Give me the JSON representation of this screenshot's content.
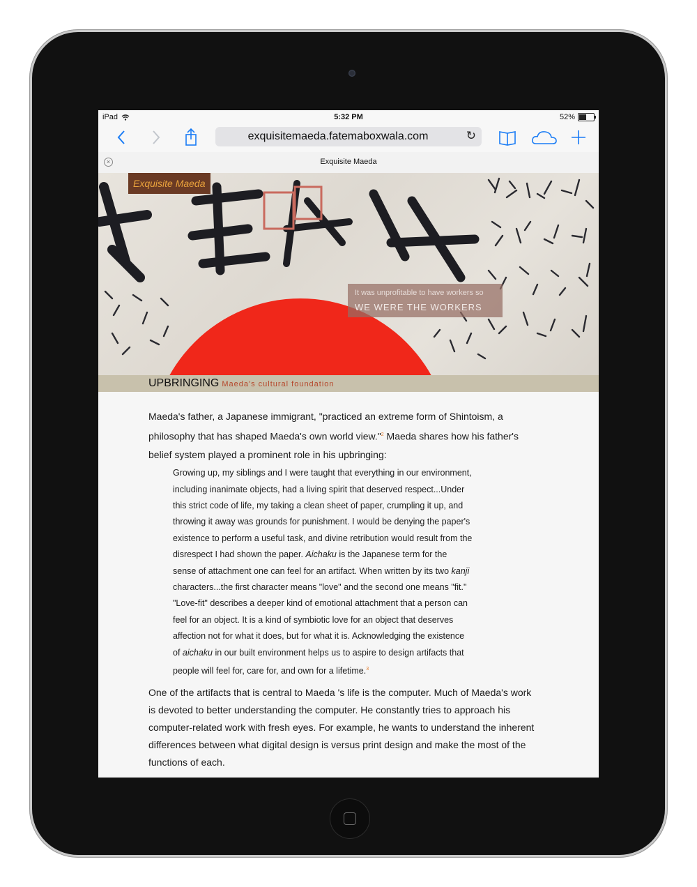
{
  "statusbar": {
    "device": "iPad",
    "time": "5:32 PM",
    "battery_pct": "52%",
    "battery_level": 0.52
  },
  "toolbar": {
    "back_icon": "chevron-left-icon",
    "forward_icon": "chevron-right-icon",
    "share_icon": "share-icon",
    "url": "exquisitemaeda.fatemaboxwala.com",
    "reload_icon": "reload-icon",
    "bookmarks_icon": "book-icon",
    "cloud_icon": "cloud-icon",
    "add_icon": "plus-icon",
    "accent_color": "#1a7cf5"
  },
  "tab": {
    "title": "Exquisite Maeda"
  },
  "hero": {
    "logo": "Exquisite Maeda",
    "quote_line1": "It was unprofitable to have workers so",
    "quote_line2": "WE WERE THE WORKERS",
    "sun_color": "#f0271a"
  },
  "section": {
    "heading": "UPBRINGING",
    "subheading": "Maeda's cultural foundation"
  },
  "article": {
    "p1_a": "Maeda's father, a Japanese immigrant, \"practiced an extreme form of Shintoism, a philosophy that has shaped Maeda's own world view.\"",
    "p1_fn": "2",
    "p1_b": " Maeda shares how his father's belief system played a prominent role in his upbringing:",
    "quote_a": "Growing up, my siblings and I were taught that everything in our environment, including inanimate objects, had a living spirit that deserved respect...Under this strict code of life, my taking a clean sheet of paper, crumpling it up, and throwing it away was grounds for punishment. I would be denying the paper's existence to perform a useful task, and divine retribution would result from the disrespect I had shown the paper. ",
    "quote_aichaku1": "Aichaku",
    "quote_b": " is the Japanese term for the sense of attachment one can feel for an artifact. When written by its two ",
    "quote_kanji": "kanji",
    "quote_c": " characters...the first character means \"love\" and the second one means \"fit.\" \"Love-fit\" describes a deeper kind of emotional attachment that a person can feel for an object. It is a kind of symbiotic love for an object that deserves affection not for what it does, but for what it is. Acknowledging the existence of ",
    "quote_aichaku2": "aichaku",
    "quote_d": " in our built environment helps us to aspire to design artifacts that people will feel for, care for, and own for a lifetime.",
    "quote_fn": "3",
    "p2": "One of the artifacts that is central to Maeda 's life is the computer. Much of Maeda's work is devoted to better understanding the computer. He constantly tries to approach his computer-related work with fresh eyes. For example, he wants to understand the inherent differences between what digital design is versus print design and make the most of the functions of each."
  }
}
